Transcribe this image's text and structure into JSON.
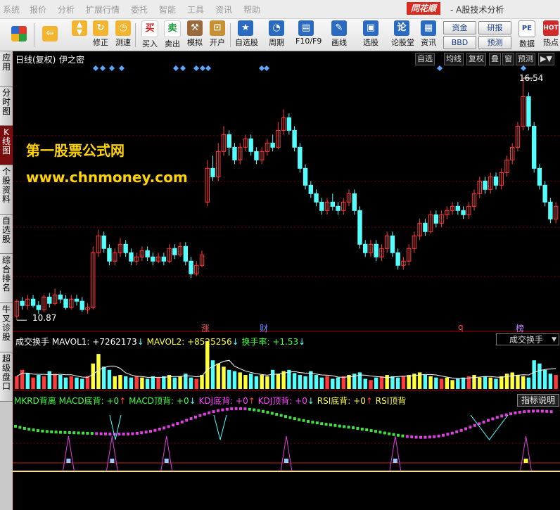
{
  "menu": {
    "items": [
      "系统",
      "报价",
      "分析",
      "扩展行情",
      "委托",
      "智能",
      "工具",
      "资讯",
      "帮助"
    ],
    "brand": "同花顺",
    "brand_sub": "- A股技术分析"
  },
  "toolbar": {
    "buttons": [
      {
        "label": "",
        "icon": "windows-grid-icon",
        "color": "#d43a2a"
      },
      {
        "label": "",
        "icon": "back-arrow-icon",
        "color": "#f0a020"
      },
      {
        "label": "",
        "icon": "up-down-arrows-icon",
        "color": "#f0a020"
      },
      {
        "label": "修正",
        "icon": "refresh-icon",
        "color": "#f0a020"
      },
      {
        "label": "测速",
        "icon": "clock-icon",
        "color": "#f0a020"
      },
      {
        "label": "买入",
        "icon": "buy-icon",
        "color": "#d63a2a"
      },
      {
        "label": "卖出",
        "icon": "sell-icon",
        "color": "#1a9c3a"
      },
      {
        "label": "模拟",
        "icon": "hammer-icon",
        "color": "#8a6a4a"
      },
      {
        "label": "开户",
        "icon": "lock-icon",
        "color": "#c08a2a"
      },
      {
        "label": "自选股",
        "icon": "star-icon",
        "color": "#2a6ac0"
      },
      {
        "label": "周期",
        "icon": "clock-cycle-icon",
        "color": "#2a6ac0"
      },
      {
        "label": "F10/F9",
        "icon": "f10-icon",
        "color": "#2a6ac0"
      },
      {
        "label": "画线",
        "icon": "pen-icon",
        "color": "#2a6ac0"
      },
      {
        "label": "选股",
        "icon": "monitor-icon",
        "color": "#2a6ac0"
      },
      {
        "label": "论股堂",
        "icon": "talk-icon",
        "color": "#2a6ac0"
      },
      {
        "label": "资讯",
        "icon": "document-icon",
        "color": "#2a6ac0"
      }
    ],
    "small_buttons": [
      "资金",
      "研报",
      "BBD",
      "预测"
    ],
    "right_buttons": [
      {
        "label": "数据",
        "icon": "pe-icon"
      },
      {
        "label": "热点",
        "icon": "hot-icon"
      }
    ]
  },
  "side_tabs": [
    {
      "label": "应用",
      "active": false
    },
    {
      "label": "分时图",
      "active": false
    },
    {
      "label": "K线图",
      "active": true
    },
    {
      "label": "个股资料",
      "active": false
    },
    {
      "label": "自选股",
      "active": false
    },
    {
      "label": "综合排名",
      "active": false
    },
    {
      "label": "牛叉诊股",
      "active": false
    },
    {
      "label": "超级盘口",
      "active": false
    }
  ],
  "kline": {
    "header_title": "日线(复权)",
    "header_stock": "伊之密",
    "top_buttons": [
      "自选",
      "均线",
      "复权",
      "叠",
      "窗",
      "预测",
      "▶▼"
    ],
    "max_label": "16.54",
    "min_label": "10.87",
    "event_labels": [
      {
        "text": "涨",
        "color": "#ff5050"
      },
      {
        "text": "财",
        "color": "#6a8aff"
      },
      {
        "text": "q",
        "color": "#ff4040"
      },
      {
        "text": "榜",
        "color": "#c080ff"
      }
    ],
    "watermark_title": "第一股票公式网",
    "watermark_url": "www.chnmoney.com"
  },
  "volume_panel": {
    "title": "成交换手",
    "mavol1_label": "MAVOL1:",
    "mavol1_value": "+7262173",
    "mavol1_arrow": "↓",
    "mavol2_label": "MAVOL2:",
    "mavol2_value": "+8525256",
    "mavol2_arrow": "↓",
    "turnover_label": "换手率:",
    "turnover_value": "+1.53",
    "turnover_arrow": "↓",
    "dropdown_value": "成交换手"
  },
  "indicator_panel": {
    "name": "MKRD背离",
    "items": [
      {
        "label": "MACD底背:",
        "value": "+0",
        "arrow": "↑",
        "color": "#40ff40"
      },
      {
        "label": "MACD顶背:",
        "value": "+0",
        "arrow": "↓",
        "color": "#40ff40"
      },
      {
        "label": "KDJ底背:",
        "value": "+0",
        "arrow": "↑",
        "color": "#ff40ff"
      },
      {
        "label": "KDJ顶背:",
        "value": "+0",
        "arrow": "↓",
        "color": "#ff40ff"
      },
      {
        "label": "RSI底背:",
        "value": "+0",
        "arrow": "↑",
        "color": "#ffff40"
      },
      {
        "label": "RSI顶背",
        "value": "",
        "arrow": "",
        "color": "#ffff40"
      }
    ],
    "explain_button": "指标说明"
  },
  "colors": {
    "up": "#ff3a3a",
    "down": "#54ffff",
    "grid": "#7a0000",
    "bg": "#000000",
    "volume_up_yellow": "#ffff3a"
  },
  "chart_data": {
    "type": "candlestick",
    "ylim": [
      10.87,
      16.54
    ],
    "max_value": 16.54,
    "min_value": 10.87,
    "candles": [
      [
        10.9,
        11.25,
        11.3,
        10.8
      ],
      [
        11.25,
        11.15,
        11.35,
        11.05
      ],
      [
        11.15,
        11.3,
        11.4,
        11.05
      ],
      [
        11.3,
        11.15,
        11.4,
        11.1
      ],
      [
        11.15,
        11.05,
        11.25,
        10.95
      ],
      [
        11.05,
        11.35,
        11.4,
        11.0
      ],
      [
        11.35,
        11.2,
        11.45,
        11.1
      ],
      [
        11.2,
        11.4,
        11.55,
        11.15
      ],
      [
        11.4,
        11.3,
        11.5,
        11.2
      ],
      [
        11.3,
        11.1,
        11.4,
        11.05
      ],
      [
        11.1,
        11.3,
        11.4,
        11.05
      ],
      [
        11.3,
        11.25,
        11.4,
        11.15
      ],
      [
        11.25,
        11.05,
        11.35,
        11.0
      ],
      [
        11.05,
        11.1,
        11.2,
        10.95
      ],
      [
        11.1,
        12.4,
        12.55,
        11.05
      ],
      [
        12.4,
        12.8,
        12.95,
        12.3
      ],
      [
        12.8,
        12.5,
        12.9,
        12.4
      ],
      [
        12.5,
        12.2,
        12.6,
        12.1
      ],
      [
        12.2,
        12.4,
        12.5,
        12.1
      ],
      [
        12.4,
        12.6,
        12.75,
        12.3
      ],
      [
        12.6,
        12.4,
        12.7,
        12.3
      ],
      [
        12.4,
        12.2,
        12.5,
        12.1
      ],
      [
        12.2,
        12.3,
        12.4,
        12.1
      ],
      [
        12.3,
        12.45,
        12.55,
        12.2
      ],
      [
        12.45,
        12.3,
        12.55,
        12.2
      ],
      [
        12.3,
        12.2,
        12.4,
        12.1
      ],
      [
        12.2,
        12.3,
        12.4,
        12.15
      ],
      [
        12.3,
        12.2,
        12.4,
        12.1
      ],
      [
        12.2,
        12.5,
        12.6,
        12.15
      ],
      [
        12.5,
        12.35,
        12.6,
        12.25
      ],
      [
        12.35,
        12.55,
        12.65,
        12.3
      ],
      [
        12.55,
        12.2,
        12.65,
        12.1
      ],
      [
        12.2,
        11.9,
        12.3,
        11.8
      ],
      [
        11.9,
        12.1,
        12.2,
        11.85
      ],
      [
        12.1,
        12.35,
        12.45,
        12.05
      ],
      [
        13.6,
        14.4,
        14.6,
        13.5
      ],
      [
        14.4,
        14.2,
        14.7,
        14.1
      ],
      [
        14.2,
        14.8,
        15.0,
        14.1
      ],
      [
        14.8,
        15.2,
        15.4,
        14.7
      ],
      [
        15.2,
        14.9,
        15.3,
        14.7
      ],
      [
        14.9,
        14.6,
        15.0,
        14.5
      ],
      [
        14.6,
        14.9,
        15.0,
        14.5
      ],
      [
        14.9,
        15.1,
        15.2,
        14.8
      ],
      [
        15.1,
        14.8,
        15.2,
        14.7
      ],
      [
        14.8,
        14.6,
        14.9,
        14.5
      ],
      [
        14.6,
        14.8,
        14.9,
        14.5
      ],
      [
        14.8,
        15.0,
        15.1,
        14.7
      ],
      [
        15.0,
        14.9,
        15.2,
        14.8
      ],
      [
        14.9,
        15.3,
        15.5,
        14.85
      ],
      [
        15.3,
        15.6,
        15.8,
        15.2
      ],
      [
        15.6,
        15.3,
        15.7,
        15.2
      ],
      [
        15.3,
        14.9,
        15.4,
        14.8
      ],
      [
        14.9,
        14.4,
        15.0,
        14.3
      ],
      [
        14.4,
        14.0,
        14.5,
        13.9
      ],
      [
        14.0,
        13.8,
        14.1,
        13.7
      ],
      [
        13.8,
        13.6,
        13.9,
        13.5
      ],
      [
        13.6,
        13.4,
        13.7,
        13.3
      ],
      [
        13.4,
        13.6,
        13.7,
        13.3
      ],
      [
        13.6,
        13.5,
        13.8,
        13.4
      ],
      [
        13.5,
        13.4,
        13.6,
        13.3
      ],
      [
        13.4,
        13.6,
        13.7,
        13.3
      ],
      [
        13.6,
        13.8,
        13.9,
        13.5
      ],
      [
        13.8,
        13.4,
        13.9,
        13.3
      ],
      [
        13.4,
        12.6,
        13.5,
        12.5
      ],
      [
        12.6,
        12.4,
        12.7,
        12.3
      ],
      [
        12.4,
        12.6,
        12.7,
        12.3
      ],
      [
        12.6,
        12.3,
        12.7,
        12.2
      ],
      [
        12.3,
        12.5,
        12.6,
        12.2
      ],
      [
        12.5,
        12.8,
        12.9,
        12.4
      ],
      [
        12.8,
        12.4,
        12.9,
        12.3
      ],
      [
        12.4,
        12.1,
        12.5,
        12.0
      ],
      [
        12.1,
        12.2,
        12.3,
        12.0
      ],
      [
        12.2,
        12.5,
        12.6,
        12.1
      ],
      [
        12.5,
        12.8,
        12.9,
        12.4
      ],
      [
        12.8,
        13.1,
        13.2,
        12.7
      ],
      [
        13.1,
        12.9,
        13.2,
        12.8
      ],
      [
        12.9,
        13.3,
        13.4,
        12.85
      ],
      [
        13.3,
        13.1,
        13.4,
        13.0
      ],
      [
        13.1,
        13.3,
        13.4,
        13.0
      ],
      [
        13.3,
        13.4,
        13.5,
        13.2
      ],
      [
        13.4,
        13.5,
        13.6,
        13.3
      ],
      [
        13.5,
        13.4,
        13.6,
        13.3
      ],
      [
        13.4,
        13.3,
        13.5,
        13.2
      ],
      [
        13.3,
        13.5,
        13.6,
        13.2
      ],
      [
        13.5,
        13.8,
        13.9,
        13.4
      ],
      [
        13.8,
        14.1,
        14.2,
        13.7
      ],
      [
        14.1,
        13.9,
        14.2,
        13.8
      ],
      [
        13.9,
        14.2,
        14.3,
        13.8
      ],
      [
        14.2,
        14.0,
        14.3,
        13.9
      ],
      [
        14.0,
        14.3,
        14.4,
        13.9
      ],
      [
        14.3,
        14.6,
        14.7,
        14.2
      ],
      [
        14.6,
        14.9,
        15.0,
        14.5
      ],
      [
        14.9,
        15.4,
        15.5,
        14.8
      ],
      [
        15.4,
        16.1,
        16.54,
        15.3
      ],
      [
        16.1,
        15.4,
        16.2,
        15.3
      ],
      [
        15.4,
        14.4,
        15.5,
        14.3
      ],
      [
        14.4,
        14.0,
        14.5,
        13.9
      ],
      [
        14.0,
        13.6,
        14.1,
        13.5
      ],
      [
        13.6,
        13.2,
        13.7,
        13.1
      ],
      [
        13.2,
        13.5,
        13.6,
        13.1
      ]
    ],
    "volumes": [
      20,
      30,
      25,
      18,
      22,
      20,
      28,
      24,
      22,
      18,
      20,
      18,
      16,
      20,
      40,
      55,
      35,
      30,
      20,
      22,
      20,
      18,
      20,
      18,
      16,
      20,
      18,
      20,
      22,
      18,
      20,
      24,
      18,
      16,
      22,
      75,
      45,
      40,
      35,
      30,
      28,
      26,
      22,
      24,
      20,
      22,
      20,
      30,
      24,
      28,
      30,
      25,
      22,
      20,
      28,
      22,
      18,
      20,
      16,
      18,
      20,
      22,
      24,
      26,
      16,
      14,
      18,
      20,
      22,
      20,
      18,
      20,
      22,
      24,
      26,
      22,
      20,
      18,
      16,
      18,
      14,
      16,
      18,
      20,
      22,
      18,
      20,
      18,
      16,
      20,
      24,
      26,
      22,
      20,
      18,
      45,
      40,
      30,
      24,
      22
    ],
    "volume_colors": [
      "r",
      "r",
      "c",
      "r",
      "c",
      "r",
      "c",
      "r",
      "c",
      "c",
      "r",
      "c",
      "c",
      "r",
      "y",
      "y",
      "c",
      "c",
      "y",
      "y",
      "c",
      "c",
      "r",
      "y",
      "c",
      "c",
      "r",
      "c",
      "y",
      "c",
      "y",
      "c",
      "c",
      "r",
      "y",
      "y",
      "c",
      "y",
      "y",
      "c",
      "c",
      "y",
      "y",
      "c",
      "c",
      "y",
      "y",
      "c",
      "y",
      "y",
      "c",
      "c",
      "c",
      "c",
      "c",
      "c",
      "c",
      "r",
      "c",
      "c",
      "r",
      "y",
      "c",
      "c",
      "c",
      "r",
      "c",
      "r",
      "y",
      "c",
      "c",
      "r",
      "y",
      "y",
      "y",
      "c",
      "y",
      "c",
      "r",
      "y",
      "y",
      "c",
      "c",
      "r",
      "y",
      "y",
      "c",
      "y",
      "c",
      "y",
      "y",
      "y",
      "y",
      "y",
      "c",
      "c",
      "c",
      "c",
      "c",
      "r"
    ],
    "indicator_events": [
      {
        "x": 0.1,
        "type": "bottom"
      },
      {
        "x": 0.18,
        "type": "bottom"
      },
      {
        "x": 0.28,
        "type": "bottom"
      },
      {
        "x": 0.5,
        "type": "bottom"
      },
      {
        "x": 0.7,
        "type": "bottom"
      },
      {
        "x": 0.94,
        "type": "top"
      }
    ]
  }
}
